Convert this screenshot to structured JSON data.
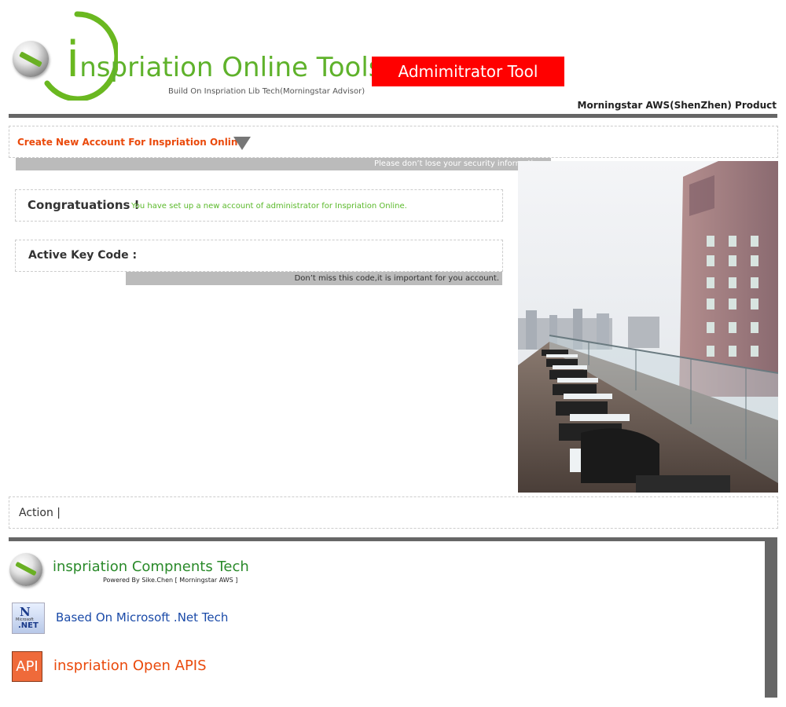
{
  "header": {
    "logo_letter": "i",
    "logo_title_rest": "nspriation Online Tools",
    "logo_subtitle": "Build On Inspriation Lib Tech(Morningstar Advisor)",
    "badge": "Admimitrator Tool",
    "product_line": "Morningstar AWS(ShenZhen) Product"
  },
  "section": {
    "title": "Create New Account For Inspriation Online",
    "security_note": "Please don’t lose your security information ."
  },
  "congrats": {
    "heading": "Congratuations !",
    "message": "You have set up a new account of administrator for Inspriation Online."
  },
  "keycode": {
    "label": "Active Key Code :",
    "value": "",
    "note": "Don’t miss this code,it is important for you account."
  },
  "action": {
    "label": "Action |"
  },
  "footer": {
    "item1_title": "inspriation Compnents Tech",
    "item1_credit": "Powered By Sike.Chen [ Morningstar AWS ]",
    "item2_title": "Based On Microsoft .Net Tech",
    "net_icon_ms": "Microsoft",
    "net_icon_label": ".NET",
    "item3_icon": "API",
    "item3_title": "inspriation Open APIS"
  },
  "icons": {
    "logo": "inspriation-ball-icon",
    "section_toggle": "triangle-down-icon",
    "footer1": "inspriation-ball-icon",
    "footer2": "dotnet-icon",
    "footer3": "api-icon"
  },
  "colors": {
    "brand_green": "#5fb22b",
    "badge_red": "#ff0000",
    "accent_orange": "#ea4a0c",
    "note_gray": "#bbbbbb",
    "rule_gray": "#666666"
  }
}
